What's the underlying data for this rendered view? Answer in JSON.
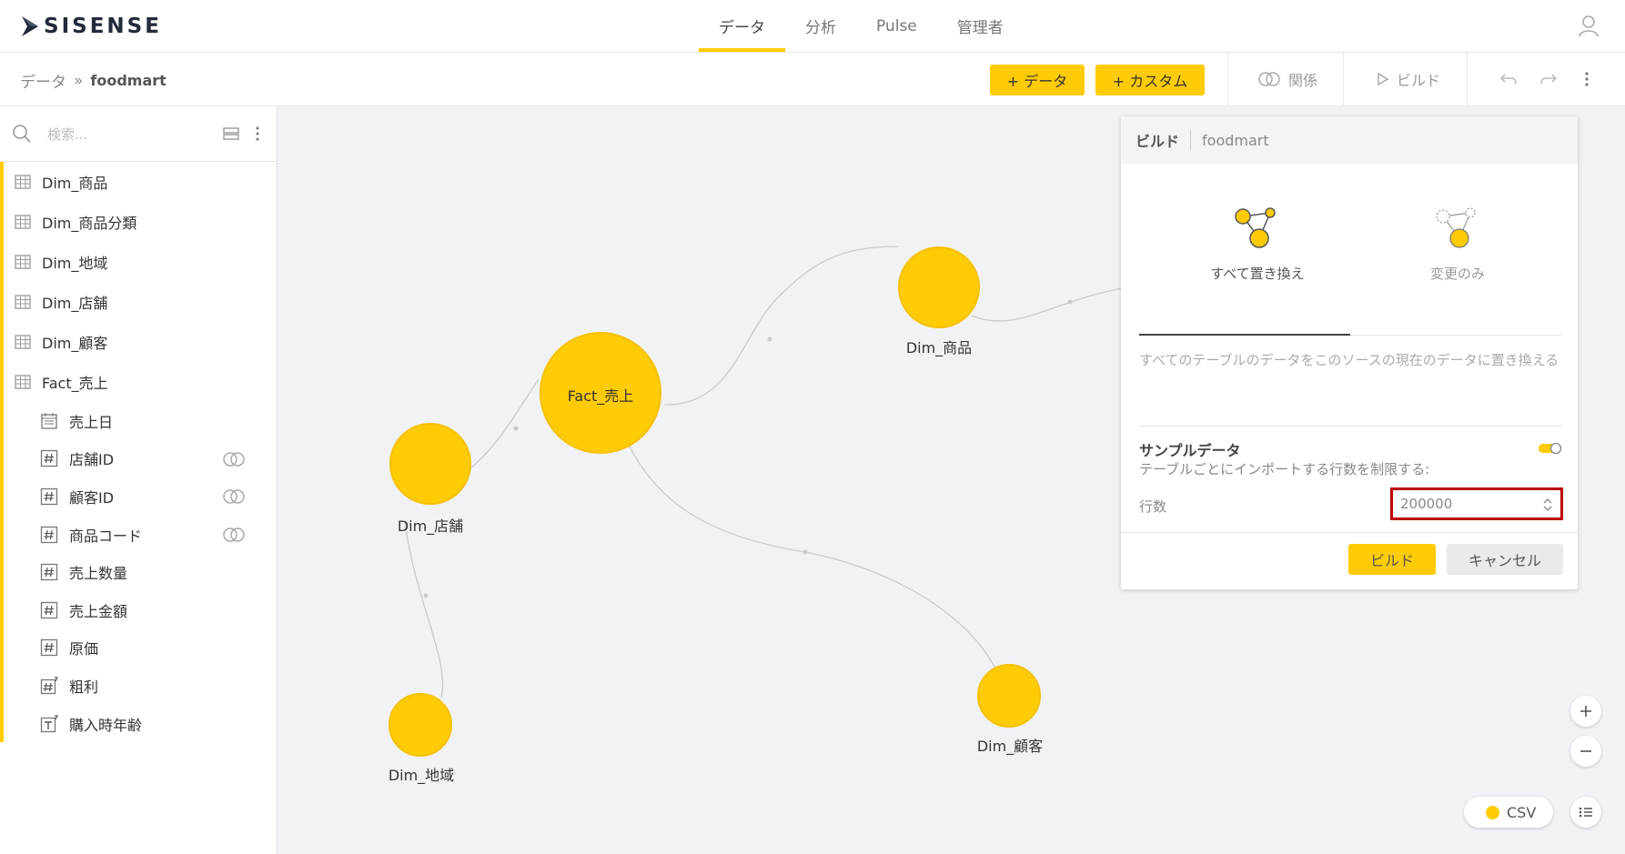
{
  "app": {
    "logo": "SISENSE"
  },
  "nav": {
    "tabs": [
      {
        "label": "データ",
        "active": true
      },
      {
        "label": "分析"
      },
      {
        "label": "Pulse"
      },
      {
        "label": "管理者"
      }
    ]
  },
  "breadcrumb": {
    "root": "データ",
    "separator": "»",
    "current": "foodmart"
  },
  "toolbar": {
    "add_data": "+ データ",
    "add_custom": "+ カスタム",
    "relations": "関係",
    "build": "ビルド"
  },
  "sidebar": {
    "search_placeholder": "検索...",
    "tables": [
      "Dim_商品",
      "Dim_商品分類",
      "Dim_地域",
      "Dim_店舗",
      "Dim_顧客",
      "Fact_売上"
    ],
    "fields": [
      {
        "label": "売上日",
        "icon": "calendar-icon",
        "relation": false
      },
      {
        "label": "店舗ID",
        "icon": "hash-icon",
        "relation": true
      },
      {
        "label": "顧客ID",
        "icon": "hash-icon",
        "relation": true
      },
      {
        "label": "商品コード",
        "icon": "hash-icon",
        "relation": true
      },
      {
        "label": "売上数量",
        "icon": "hash-icon",
        "relation": false
      },
      {
        "label": "売上金額",
        "icon": "hash-icon",
        "relation": false
      },
      {
        "label": "原価",
        "icon": "hash-icon",
        "relation": false
      },
      {
        "label": "粗利",
        "icon": "custom-hash-icon",
        "relation": false
      },
      {
        "label": "購入時年齢",
        "icon": "custom-text-icon",
        "relation": false
      }
    ]
  },
  "canvas": {
    "nodes": {
      "fact": "Fact_売上",
      "product": "Dim_商品",
      "store": "Dim_店舗",
      "region": "Dim_地域",
      "customer": "Dim_顧客"
    }
  },
  "build_panel": {
    "title": "ビルド",
    "model": "foodmart",
    "option_full": "すべて置き換え",
    "option_changes": "変更のみ",
    "description": "すべてのテーブルのデータをこのソースの現在のデータに置き換える",
    "sample_title": "サンプルデータ",
    "sample_subtitle": "テーブルごとにインポートする行数を制限する:",
    "rows_label": "行数",
    "rows_value": "200000",
    "build_button": "ビルド",
    "cancel_button": "キャンセル"
  },
  "legend": {
    "csv": "CSV"
  },
  "colors": {
    "accent": "#ffcb05",
    "highlight_border": "#b00000"
  }
}
